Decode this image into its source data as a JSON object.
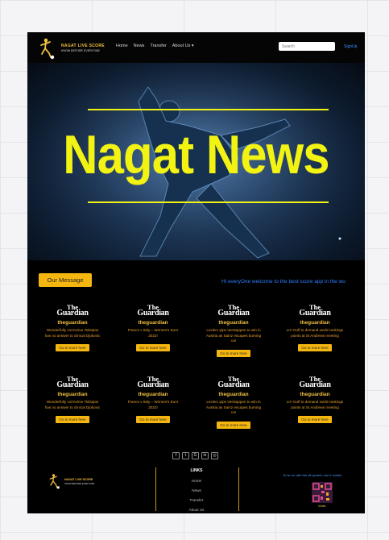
{
  "nav": {
    "brand_title": "NAGAT LIVE SCORE",
    "brand_subtitle": "KNOW BEFORE EVERYONE",
    "links": [
      "Home",
      "News",
      "Transfer",
      "About Us ▾"
    ],
    "search_placeholder": "Search",
    "signup_label": "SignUp"
  },
  "hero": {
    "title": "Nagat News"
  },
  "message": {
    "button_label": "Our Message",
    "marquee_text": "Hi everyOne welcome to the best score app in the wo"
  },
  "news_cards": [
    {
      "logo_the": "The",
      "logo_name": "Guardian",
      "source": "theguardian",
      "desc": "Wonderfully corrective Tsitsipas has no answer to clinical Djokovic",
      "button": "Go to more here"
    },
    {
      "logo_the": "The",
      "logo_name": "Guardian",
      "source": "theguardian",
      "desc": "France v Italy – Women's Euro 2022!",
      "button": "Go to more here"
    },
    {
      "logo_the": "The",
      "logo_name": "Guardian",
      "source": "theguardian",
      "desc": "Leclerc pips Verstappen to win in Austria as Sainz escapes burning car",
      "button": "Go to more here"
    },
    {
      "logo_the": "The",
      "logo_name": "Guardian",
      "source": "theguardian",
      "desc": "LIV Golf to demand world rankings points at St Andrews meeting",
      "button": "Go to more here"
    },
    {
      "logo_the": "The",
      "logo_name": "Guardian",
      "source": "theguardian",
      "desc": "Wonderfully corrective Tsitsipas has no answer to clinical Djokovic",
      "button": "Go to more here"
    },
    {
      "logo_the": "The",
      "logo_name": "Guardian",
      "source": "theguardian",
      "desc": "France v Italy – Women's Euro 2022!",
      "button": "Go to more here"
    },
    {
      "logo_the": "The",
      "logo_name": "Guardian",
      "source": "theguardian",
      "desc": "Leclerc pips Verstappen to win in Austria as Sainz escapes burning car",
      "button": "Go to more here"
    },
    {
      "logo_the": "The",
      "logo_name": "Guardian",
      "source": "theguardian",
      "desc": "LIV Golf to demand world rankings points at St Andrews meeting",
      "button": "Go to more here"
    }
  ],
  "social_icons": [
    "facebook-icon",
    "twitter-icon",
    "google-icon",
    "linkedin-icon",
    "github-icon"
  ],
  "social_glyphs": [
    "f",
    "t",
    "G",
    "in",
    "◎"
  ],
  "footer": {
    "brand_title": "NAGAT LIVE SCORE",
    "brand_subtitle": "KNOW BEFORE EVERYONE",
    "links_title": "LINKS",
    "links": [
      "Home",
      "News",
      "Transfer",
      "About Us"
    ],
    "app_text": "To be on with the all sporter, use it mobile",
    "qr_label": "Mobile"
  },
  "colors": {
    "accent_yellow": "#f5b70f",
    "hero_text": "#f2f213",
    "link_blue": "#2e7fff",
    "background": "#000000"
  }
}
